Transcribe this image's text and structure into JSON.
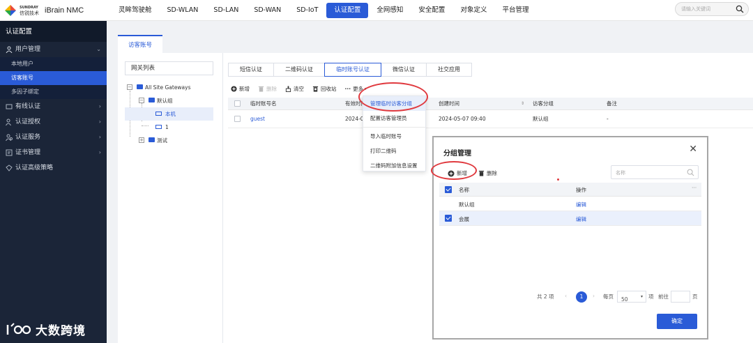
{
  "brand": {
    "name_en": "SUNDRAY",
    "name_cn": "信锐技术",
    "product": "iBrain NMC"
  },
  "topnav": [
    {
      "label": "灵眸驾驶舱",
      "active": false
    },
    {
      "label": "SD-WLAN",
      "active": false
    },
    {
      "label": "SD-LAN",
      "active": false
    },
    {
      "label": "SD-WAN",
      "active": false
    },
    {
      "label": "SD-IoT",
      "active": false
    },
    {
      "label": "认证配置",
      "active": true
    },
    {
      "label": "全网感知",
      "active": false
    },
    {
      "label": "安全配置",
      "active": false
    },
    {
      "label": "对象定义",
      "active": false
    },
    {
      "label": "平台管理",
      "active": false
    }
  ],
  "search": {
    "placeholder": "请输入关键词"
  },
  "sidebar": {
    "title": "认证配置",
    "user_mgmt": {
      "label": "用户管理",
      "icon": "user-icon",
      "chevron": "⌄"
    },
    "sub_items": [
      {
        "label": "本地用户"
      },
      {
        "label": "访客账号"
      },
      {
        "label": "多因子绑定"
      }
    ],
    "groups": [
      {
        "label": "有线认证",
        "icon": "wired-icon",
        "chevron": "›"
      },
      {
        "label": "认证授权",
        "icon": "auth-icon",
        "chevron": "›"
      },
      {
        "label": "认证服务",
        "icon": "service-icon",
        "chevron": "›"
      },
      {
        "label": "证书管理",
        "icon": "cert-icon",
        "chevron": "›"
      },
      {
        "label": "认证高级策略",
        "icon": "policy-icon",
        "chevron": ""
      }
    ]
  },
  "page_tab": "访客账号",
  "gateway": {
    "title": "网关列表",
    "tree": {
      "root": "All Site Gateways",
      "group": "默认组",
      "local": "本机",
      "node1": "1",
      "test": "测试"
    }
  },
  "subtabs": [
    "短信认证",
    "二维码认证",
    "临时账号认证",
    "微信认证",
    "社交应用"
  ],
  "toolbar": {
    "add": "新增",
    "delete": "删除",
    "clear": "清空",
    "recycle": "回收站",
    "more": "更多"
  },
  "table": {
    "headers": {
      "account": "临时账号名",
      "valid": "有效时间",
      "created": "创建时间",
      "group": "访客分组",
      "note": "备注"
    },
    "row": {
      "account": "guest",
      "valid": "2024-05-0",
      "created": "2024-05-07 09:40",
      "group": "默认组",
      "note": "-"
    }
  },
  "more_menu": [
    "管理临时访客分组",
    "配置访客管理员",
    "导入临时账号",
    "打印二维码",
    "二维码附加信息设置"
  ],
  "modal": {
    "title": "分组管理",
    "add": "新增",
    "delete": "删除",
    "search_placeholder": "名称",
    "headers": {
      "name": "名称",
      "action": "操作"
    },
    "rows": [
      {
        "name": "默认组",
        "action": "编辑",
        "checked": false
      },
      {
        "name": "会展",
        "action": "编辑",
        "checked": true
      }
    ],
    "pager": {
      "total": "共 2 项",
      "page": "1",
      "per_page_label": "每页",
      "per_page": "50",
      "unit": "项",
      "goto": "前往",
      "page_unit": "页"
    },
    "ok": "确定"
  },
  "watermark": "大数跨境",
  "colors": {
    "primary": "#2a5bd7",
    "sidebar": "#1b2538",
    "annotation": "#e0393e"
  }
}
